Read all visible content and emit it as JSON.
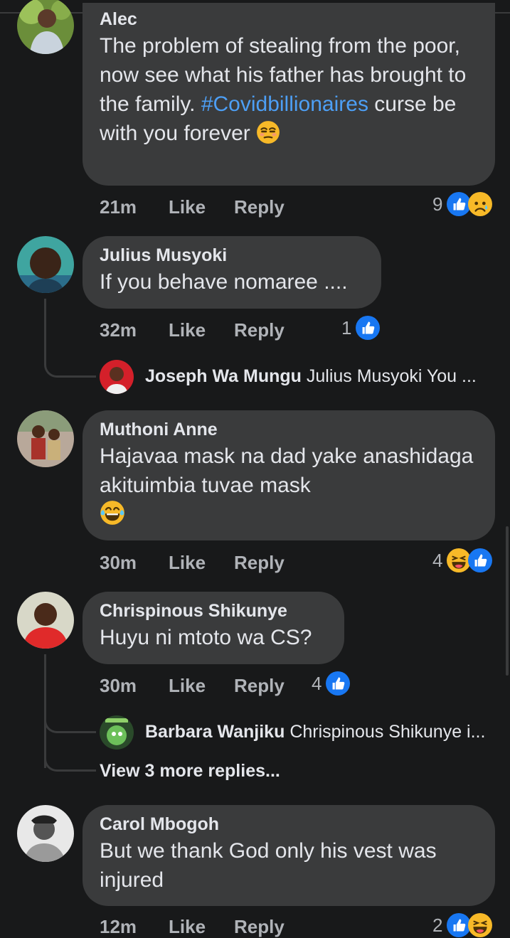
{
  "comments": [
    {
      "name": "Alec",
      "text_parts": [
        "The problem of stealing from the poor, now see what his father has brought to the family. ",
        "#Covidbillionaires",
        " curse be with you forever"
      ],
      "time": "21m",
      "like_label": "Like",
      "reply_label": "Reply",
      "reaction_count": "9",
      "reactions": [
        "like-icon",
        "sad-icon"
      ]
    },
    {
      "name": "Julius Musyoki",
      "text": "If you behave nomaree ....",
      "time": "32m",
      "like_label": "Like",
      "reply_label": "Reply",
      "reaction_count": "1",
      "reactions": [
        "like-icon"
      ],
      "reply_preview": {
        "name": "Joseph Wa Mungu",
        "text": "Julius Musyoki You ..."
      }
    },
    {
      "name": "Muthoni Anne",
      "text": "Hajavaa mask na dad yake anashidaga akituimbia tuvae mask",
      "time": "30m",
      "like_label": "Like",
      "reply_label": "Reply",
      "reaction_count": "4",
      "reactions": [
        "haha-icon",
        "like-icon"
      ]
    },
    {
      "name": "Chrispinous Shikunye",
      "text": "Huyu ni mtoto wa CS?",
      "time": "30m",
      "like_label": "Like",
      "reply_label": "Reply",
      "reaction_count": "4",
      "reactions": [
        "like-icon"
      ],
      "reply_preview": {
        "name": "Barbara Wanjiku",
        "text": "Chrispinous Shikunye i..."
      },
      "view_more": "View 3 more replies..."
    },
    {
      "name": "Carol Mbogoh",
      "text": "But we thank God only his vest was injured",
      "time": "12m",
      "like_label": "Like",
      "reply_label": "Reply",
      "reaction_count": "2",
      "reactions": [
        "like-icon",
        "haha-icon"
      ]
    }
  ],
  "colors": {
    "background": "#18191a",
    "bubble": "#3a3b3c",
    "text": "#e4e6eb",
    "meta": "#b0b3b8",
    "hashtag": "#4d9ff5",
    "like": "#1877f2",
    "emoji": "#f7b928"
  }
}
